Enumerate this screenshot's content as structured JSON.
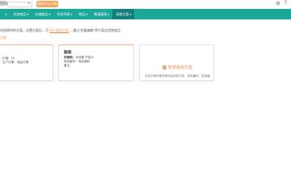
{
  "topbar": {
    "title": "团队",
    "search_clear": "✕",
    "action_button": "帮助中心/付费",
    "icons": [
      "settings-icon",
      "help-icon"
    ]
  },
  "nav": {
    "items": [
      {
        "label": "·",
        "active": false
      },
      {
        "label": "任务商品",
        "active": false
      },
      {
        "label": "店铺商品",
        "active": false
      },
      {
        "label": "任务列表",
        "active": false
      },
      {
        "label": "商品",
        "active": false
      },
      {
        "label": "数据报表",
        "active": false
      },
      {
        "label": "系统方案",
        "active": true
      }
    ],
    "arrow": "▾"
  },
  "info": {
    "prefix": "系统提供的方案，设置方案后，可",
    "link": "进入商品方案",
    "suffix": "，通过\"批量编辑\"将方案应用到商品"
  },
  "section": {
    "title": "方案"
  },
  "cards": [
    {
      "lines": [
        {
          "label": "价格：",
          "value": "15"
        },
        {
          "label": "",
          "value": "生产日期、商品日期"
        }
      ]
    },
    {
      "title": "服装",
      "rows": [
        {
          "label": "识别码：",
          "value": "未设置  不显示"
        },
        {
          "label": "商品编号：",
          "value": "商品编码"
        },
        {
          "label": "备注：",
          "value": ""
        }
      ]
    }
  ],
  "add_card": {
    "label": "新增系统方案",
    "plus": "+",
    "desc": "包含识别码等多种商品信息字段，商品编码，批量编"
  },
  "colors": {
    "nav_bg": "#1aa898",
    "nav_active": "#11807a",
    "accent": "#f5894a",
    "button": "#f5a25c"
  }
}
